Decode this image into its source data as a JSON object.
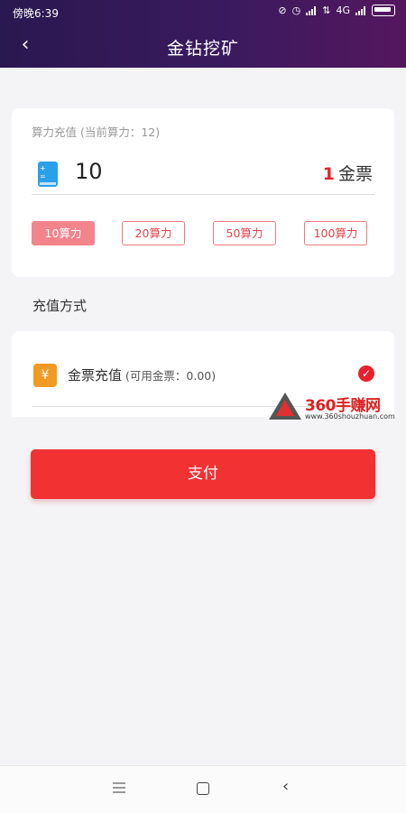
{
  "status_bar": {
    "time": "傍晚6:39",
    "network": "4G"
  },
  "header": {
    "back_icon": "chevron-left-icon",
    "title": "金钻挖矿"
  },
  "recharge": {
    "subtitle": "算力充值 (当前算力：12)",
    "amount": "10",
    "price_value": "1",
    "price_unit": "金票",
    "options": [
      {
        "label": "10算力",
        "selected": true
      },
      {
        "label": "20算力",
        "selected": false
      },
      {
        "label": "50算力",
        "selected": false
      },
      {
        "label": "100算力",
        "selected": false
      }
    ]
  },
  "payment": {
    "section_label": "充值方式",
    "method_label": "金票充值",
    "method_sub": "(可用金票：0.00)",
    "selected": true
  },
  "watermark": {
    "brand": "360手赚网",
    "url": "www.360shouzhuan.com"
  },
  "pay_button": {
    "label": "支付"
  },
  "colors": {
    "accent": "#f23133",
    "header": "#3a1a5e",
    "option_active": "#f2848c"
  }
}
